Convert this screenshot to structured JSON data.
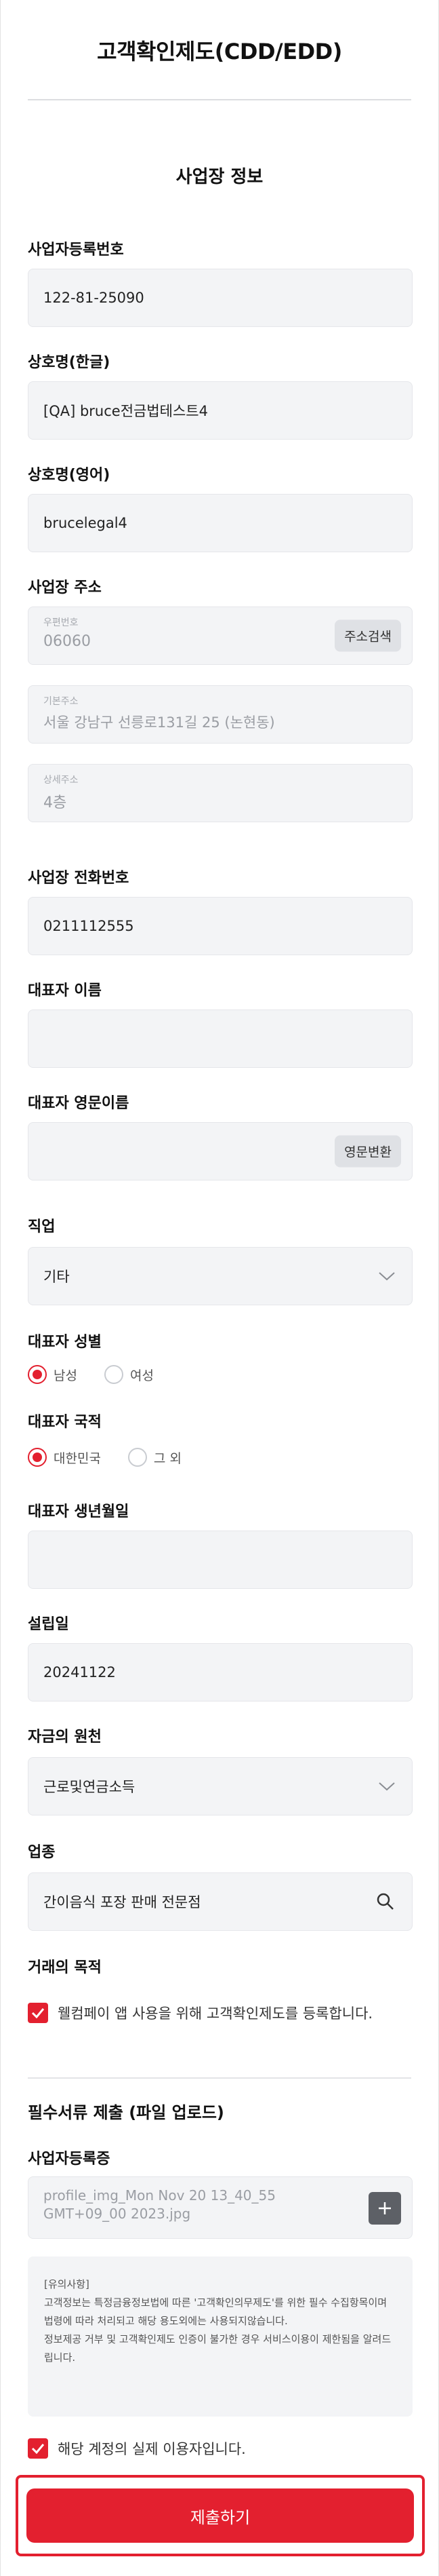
{
  "header": {
    "title": "고객확인제도(CDD/EDD)"
  },
  "section": {
    "title": "사업장 정보"
  },
  "business_reg_no": {
    "label": "사업자등록번호",
    "value": "122-81-25090"
  },
  "company_name_kr": {
    "label": "상호명(한글)",
    "value": "[QA] bruce전금법테스트4"
  },
  "company_name_en": {
    "label": "상호명(영어)",
    "value": "brucelegal4"
  },
  "address": {
    "label": "사업장 주소",
    "zip_label": "우편번호",
    "zip_value": "06060",
    "search_button": "주소검색",
    "base_label": "기본주소",
    "base_value": "서울 강남구 선릉로131길 25 (논현동)",
    "detail_label": "상세주소",
    "detail_value": "4층"
  },
  "phone": {
    "label": "사업장 전화번호",
    "value": "0211112555"
  },
  "rep_name": {
    "label": "대표자 이름",
    "value": ""
  },
  "rep_name_en": {
    "label": "대표자 영문이름",
    "value": "",
    "convert_button": "영문변환"
  },
  "job": {
    "label": "직업",
    "value": "기타"
  },
  "rep_gender": {
    "label": "대표자 성별",
    "options": [
      "남성",
      "여성"
    ],
    "selected": "남성"
  },
  "rep_nationality": {
    "label": "대표자 국적",
    "options": [
      "대한민국",
      "그 외"
    ],
    "selected": "대한민국"
  },
  "rep_birth": {
    "label": "대표자 생년월일",
    "value": ""
  },
  "founded": {
    "label": "설립일",
    "value": "20241122"
  },
  "fund_source": {
    "label": "자금의 원천",
    "value": "근로및연금소득"
  },
  "industry": {
    "label": "업종",
    "value": "간이음식 포장 판매 전문점"
  },
  "purpose": {
    "label": "거래의 목적",
    "check_text": "웰컴페이 앱 사용을 위해 고객확인제도를 등록합니다.",
    "checked": true
  },
  "docs": {
    "title": "필수서류 제출 (파일 업로드)",
    "reg_cert_label": "사업자등록증",
    "file_name": "profile_img_Mon Nov 20 13_40_55 GMT+09_00 2023.jpg"
  },
  "notice": {
    "heading": "[유의사항]",
    "line1": "고객정보는 특정금융정보법에 따른 '고객확인의무제도'를 위한 필수 수집항목이며 법령에 따라 처리되고 해당 용도외에는 사용되지않습니다.",
    "line2": "정보제공 거부 및 고객확인제도 인증이 불가한 경우 서비스이용이 제한됨을 알려드립니다."
  },
  "owner_confirm": {
    "text": "해당 계정의 실제 이용자입니다.",
    "checked": true
  },
  "submit": {
    "label": "제출하기"
  },
  "colors": {
    "accent": "#e3202f",
    "field_bg": "#f3f4f6"
  }
}
